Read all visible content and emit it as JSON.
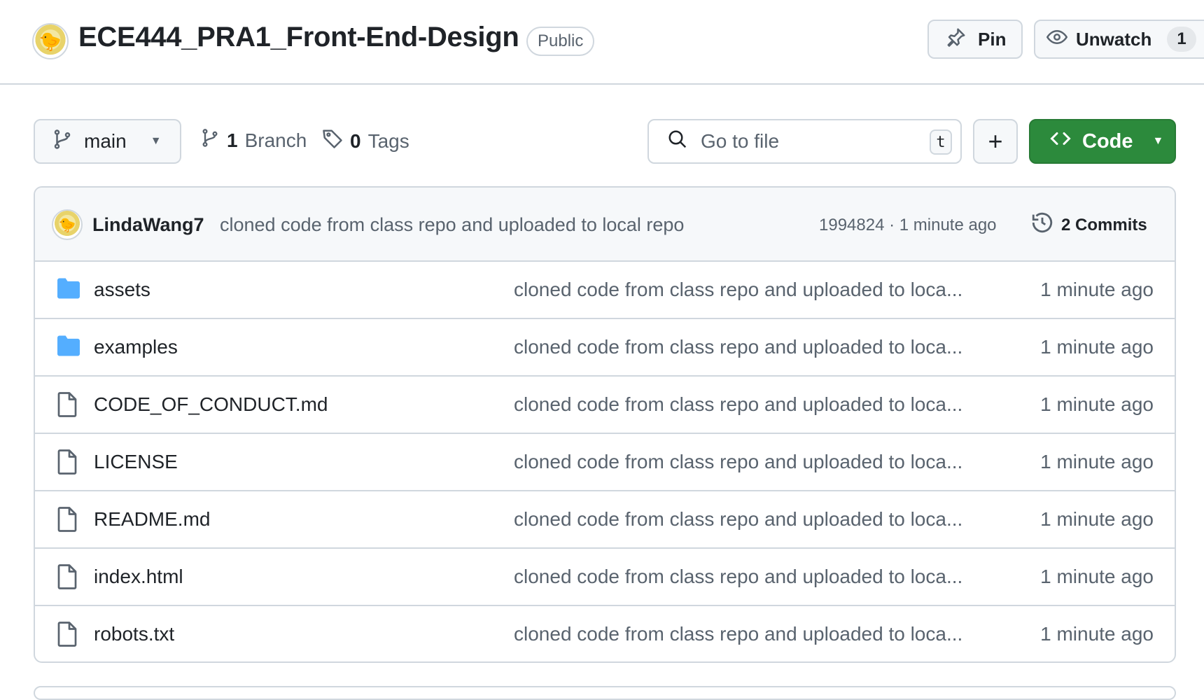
{
  "header": {
    "repo_name": "ECE444_PRA1_Front-End-Design",
    "visibility": "Public",
    "pin_label": "Pin",
    "watch_label": "Unwatch",
    "watch_count": "1"
  },
  "toolbar": {
    "branch_name": "main",
    "branch_count": "1",
    "branch_label": "Branch",
    "tag_count": "0",
    "tag_label": "Tags",
    "search_placeholder": "Go to file",
    "search_shortcut": "t",
    "add_label": "+",
    "code_label": "Code"
  },
  "commit": {
    "author": "LindaWang7",
    "message": "cloned code from class repo and uploaded to local repo",
    "hash_time": "1994824 · 1 minute ago",
    "commits_label": "2 Commits"
  },
  "files": [
    {
      "name": "assets",
      "type": "folder",
      "commit": "cloned code from class repo and uploaded to loca...",
      "time": "1 minute ago"
    },
    {
      "name": "examples",
      "type": "folder",
      "commit": "cloned code from class repo and uploaded to loca...",
      "time": "1 minute ago"
    },
    {
      "name": "CODE_OF_CONDUCT.md",
      "type": "file",
      "commit": "cloned code from class repo and uploaded to loca...",
      "time": "1 minute ago"
    },
    {
      "name": "LICENSE",
      "type": "file",
      "commit": "cloned code from class repo and uploaded to loca...",
      "time": "1 minute ago"
    },
    {
      "name": "README.md",
      "type": "file",
      "commit": "cloned code from class repo and uploaded to loca...",
      "time": "1 minute ago"
    },
    {
      "name": "index.html",
      "type": "file",
      "commit": "cloned code from class repo and uploaded to loca...",
      "time": "1 minute ago"
    },
    {
      "name": "robots.txt",
      "type": "file",
      "commit": "cloned code from class repo and uploaded to loca...",
      "time": "1 minute ago"
    }
  ],
  "colors": {
    "accent_green": "#2c8a3c",
    "folder_blue": "#54aeff",
    "border": "#d0d7de",
    "muted_text": "#59636e"
  }
}
